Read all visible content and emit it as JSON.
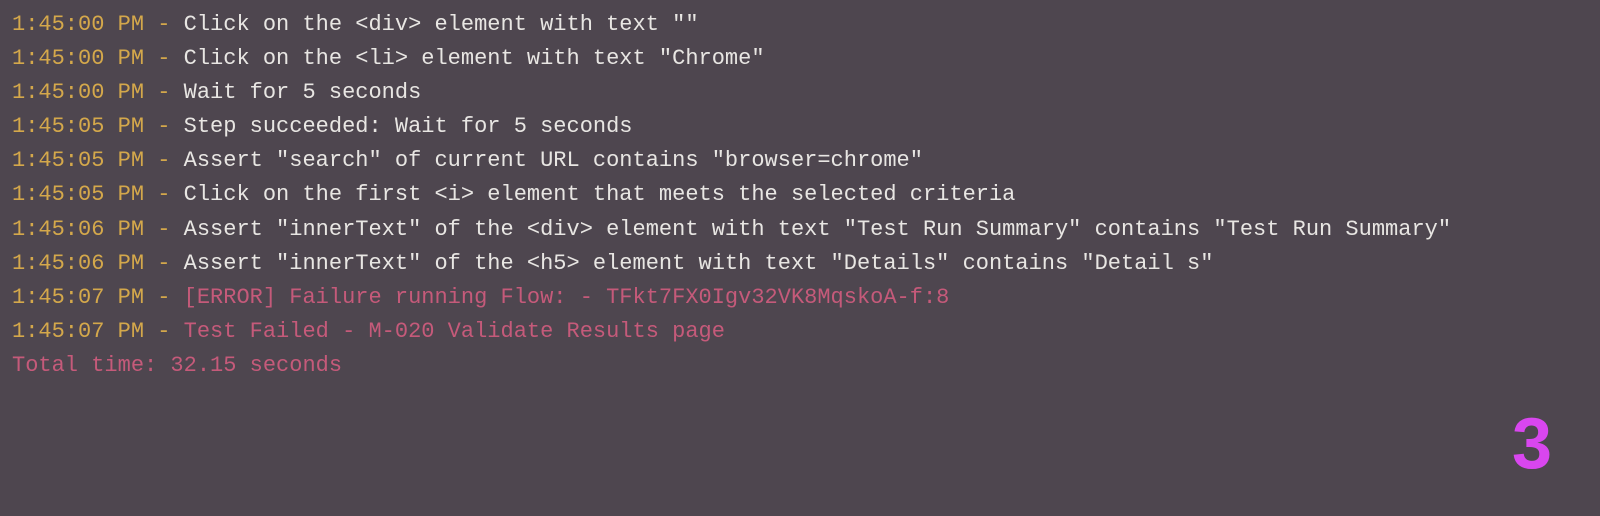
{
  "entries": [
    {
      "timestamp": "1:45:00 PM",
      "message": "Click on the <div> element with text \"\"",
      "type": "normal"
    },
    {
      "timestamp": "1:45:00 PM",
      "message": "Click on the <li> element with text \"Chrome\"",
      "type": "normal"
    },
    {
      "timestamp": "1:45:00 PM",
      "message": "Wait for 5 seconds",
      "type": "normal"
    },
    {
      "timestamp": "1:45:05 PM",
      "message": "Step succeeded: Wait for 5 seconds",
      "type": "normal"
    },
    {
      "timestamp": "1:45:05 PM",
      "message": "Assert \"search\" of current URL contains \"browser=chrome\"",
      "type": "normal"
    },
    {
      "timestamp": "1:45:05 PM",
      "message": "Click on the first <i> element that meets the selected criteria",
      "type": "normal"
    },
    {
      "timestamp": "1:45:06 PM",
      "message": "Assert \"innerText\" of the <div> element with text \"Test Run Summary\" contains \"Test Run Summary\"",
      "type": "normal"
    },
    {
      "timestamp": "1:45:06 PM",
      "message": "Assert \"innerText\" of the <h5> element with text \"Details\" contains \"Detail s\"",
      "type": "normal"
    },
    {
      "timestamp": "1:45:07 PM",
      "message": "[ERROR] Failure running Flow: - TFkt7FX0Igv32VK8MqskoA-f:8",
      "type": "error"
    },
    {
      "timestamp": "1:45:07 PM",
      "message": "Test Failed - M-020 Validate Results page",
      "type": "error"
    }
  ],
  "separator": " - ",
  "footer": "Total time: 32.15 seconds",
  "annotation": "3"
}
